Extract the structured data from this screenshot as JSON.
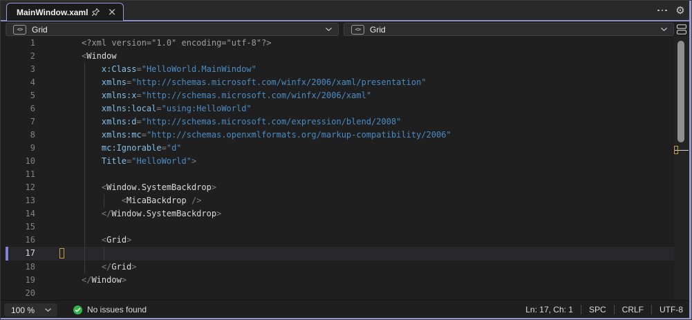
{
  "tab": {
    "title": "MainWindow.xaml"
  },
  "tab_actions": {
    "more_icon": "more-options-ellipsis",
    "settings_icon": "gear"
  },
  "navbar": {
    "left_selector": "Grid",
    "right_selector": "Grid",
    "element_icon": "xml-tag-icon",
    "glyph": "<>"
  },
  "editor": {
    "language": "XAML",
    "current_line": 17,
    "caret": {
      "line": 17,
      "ch": 1
    },
    "guides": [
      {
        "col": 0,
        "from": 3,
        "to": 18
      },
      {
        "col": 4,
        "from": 13,
        "to": 13
      },
      {
        "col": 4,
        "from": 17,
        "to": 17
      }
    ],
    "lines": [
      {
        "n": 1,
        "t": [
          [
            "pi",
            "<?xml version=\"1.0\" encoding=\"utf-8\"?>"
          ]
        ]
      },
      {
        "n": 2,
        "t": [
          [
            "delim",
            "<"
          ],
          [
            "name",
            "Window"
          ]
        ]
      },
      {
        "n": 3,
        "t": [
          [
            "text",
            "    "
          ],
          [
            "attr",
            "x:Class"
          ],
          [
            "delim",
            "="
          ],
          [
            "val",
            "\"HelloWorld.MainWindow\""
          ]
        ]
      },
      {
        "n": 4,
        "t": [
          [
            "text",
            "    "
          ],
          [
            "attr",
            "xmlns"
          ],
          [
            "delim",
            "="
          ],
          [
            "val",
            "\"http://schemas.microsoft.com/winfx/2006/xaml/presentation\""
          ]
        ]
      },
      {
        "n": 5,
        "t": [
          [
            "text",
            "    "
          ],
          [
            "attr",
            "xmlns:x"
          ],
          [
            "delim",
            "="
          ],
          [
            "val",
            "\"http://schemas.microsoft.com/winfx/2006/xaml\""
          ]
        ]
      },
      {
        "n": 6,
        "t": [
          [
            "text",
            "    "
          ],
          [
            "attr",
            "xmlns:local"
          ],
          [
            "delim",
            "="
          ],
          [
            "val",
            "\"using:HelloWorld\""
          ]
        ]
      },
      {
        "n": 7,
        "t": [
          [
            "text",
            "    "
          ],
          [
            "attr",
            "xmlns:d"
          ],
          [
            "delim",
            "="
          ],
          [
            "val",
            "\"http://schemas.microsoft.com/expression/blend/2008\""
          ]
        ]
      },
      {
        "n": 8,
        "t": [
          [
            "text",
            "    "
          ],
          [
            "attr",
            "xmlns:mc"
          ],
          [
            "delim",
            "="
          ],
          [
            "val",
            "\"http://schemas.openxmlformats.org/markup-compatibility/2006\""
          ]
        ]
      },
      {
        "n": 9,
        "t": [
          [
            "text",
            "    "
          ],
          [
            "attr",
            "mc:Ignorable"
          ],
          [
            "delim",
            "="
          ],
          [
            "val",
            "\"d\""
          ]
        ]
      },
      {
        "n": 10,
        "t": [
          [
            "text",
            "    "
          ],
          [
            "attr",
            "Title"
          ],
          [
            "delim",
            "="
          ],
          [
            "val",
            "\"HelloWorld\""
          ],
          [
            "delim",
            ">"
          ]
        ]
      },
      {
        "n": 11,
        "t": []
      },
      {
        "n": 12,
        "t": [
          [
            "text",
            "    "
          ],
          [
            "delim",
            "<"
          ],
          [
            "name",
            "Window.SystemBackdrop"
          ],
          [
            "delim",
            ">"
          ]
        ]
      },
      {
        "n": 13,
        "t": [
          [
            "text",
            "        "
          ],
          [
            "delim",
            "<"
          ],
          [
            "name",
            "MicaBackdrop"
          ],
          [
            "text",
            " "
          ],
          [
            "delim",
            "/>"
          ]
        ]
      },
      {
        "n": 14,
        "t": [
          [
            "text",
            "    "
          ],
          [
            "delim",
            "</"
          ],
          [
            "name",
            "Window.SystemBackdrop"
          ],
          [
            "delim",
            ">"
          ]
        ]
      },
      {
        "n": 15,
        "t": []
      },
      {
        "n": 16,
        "t": [
          [
            "text",
            "    "
          ],
          [
            "delim",
            "<"
          ],
          [
            "name",
            "Grid"
          ],
          [
            "delim",
            ">"
          ]
        ]
      },
      {
        "n": 17,
        "t": []
      },
      {
        "n": 18,
        "t": [
          [
            "text",
            "    "
          ],
          [
            "delim",
            "</"
          ],
          [
            "name",
            "Grid"
          ],
          [
            "delim",
            ">"
          ]
        ]
      },
      {
        "n": 19,
        "t": [
          [
            "delim",
            "</"
          ],
          [
            "name",
            "Window"
          ],
          [
            "delim",
            ">"
          ]
        ]
      },
      {
        "n": 20,
        "t": []
      }
    ]
  },
  "statusbar": {
    "zoom": "100 %",
    "issues": "No issues found",
    "position": "Ln: 17, Ch: 1",
    "indicators": [
      "SPC",
      "CRLF",
      "UTF-8"
    ]
  },
  "colors": {
    "accent": "#a195de",
    "accentline": "#8d8dd0",
    "edge": "#9898ce",
    "gutterbar": "#8282d8",
    "caretbox": "#c2a23c",
    "thumb": "#8f8f8f",
    "green": "#36b24a",
    "c-pi": "#9e9e9e",
    "c-delim": "#7e7e7e",
    "c-name": "#dcdcdc",
    "c-attr": "#83c0ea",
    "c-val": "#4a8cc4"
  }
}
